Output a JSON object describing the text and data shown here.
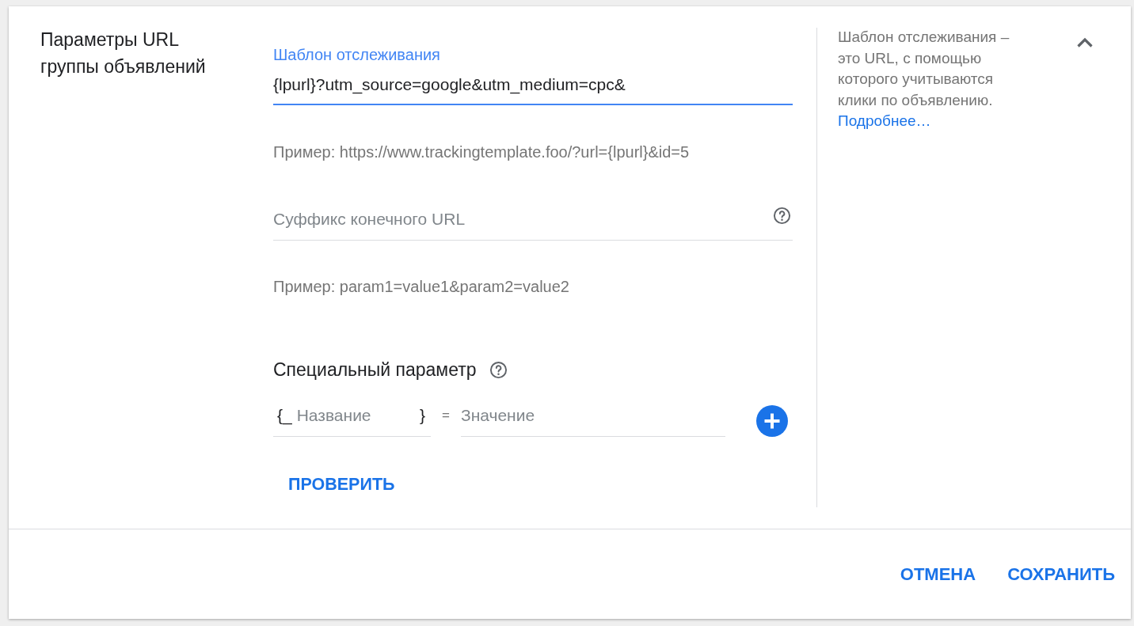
{
  "section": {
    "title": "Параметры URL группы объявлений",
    "expanded": true
  },
  "fields": [
    {
      "label": "Шаблон отслеживания",
      "value": "{lpurl}?utm_source=google&utm_medium=cpc&",
      "focused": true,
      "help": false,
      "example": "Пример: https://www.trackingtemplate.foo/?url={lpurl}&id=5"
    },
    {
      "placeholder": "Суффикс конечного URL",
      "focused": false,
      "help": true,
      "example": "Пример: param1=value1&param2=value2"
    }
  ],
  "custom_parameter": {
    "title": "Специальный параметр",
    "help": true,
    "name_prefix": "{_",
    "name_placeholder": "Название",
    "name_suffix": "}",
    "equals": "=",
    "value_placeholder": "Значение"
  },
  "check_button": {
    "label": "ПРОВЕРИТЬ"
  },
  "help_panel": {
    "text": "Шаблон отслеживания – это URL, с помощью которого учитываются клики по объявлению.",
    "link": "Подробнее…"
  },
  "footer": {
    "buttons": [
      {
        "label": "ОТМЕНА"
      },
      {
        "label": "СОХРАНИТЬ"
      }
    ]
  }
}
